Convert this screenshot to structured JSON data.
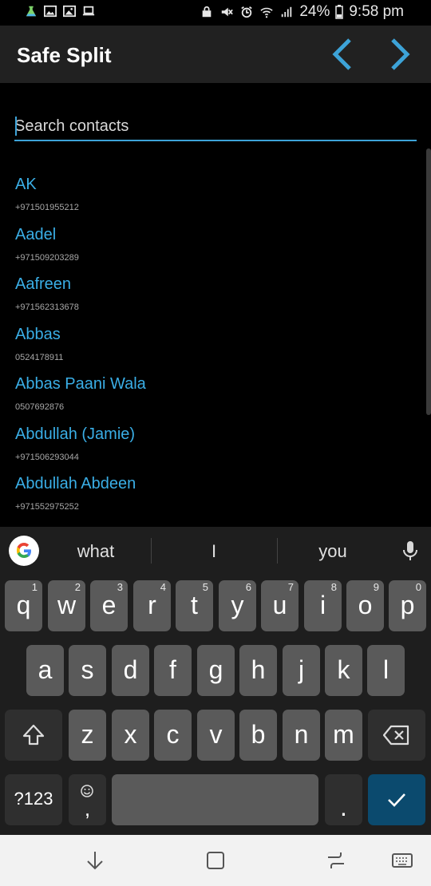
{
  "status_bar": {
    "battery": "24%",
    "time": "9:58 pm",
    "left_icons": [
      "flask-icon",
      "photo-icon",
      "image-icon",
      "laptop-icon"
    ],
    "right_icons": [
      "vpn-icon",
      "mute-icon",
      "alarm-icon",
      "wifi-icon",
      "signal-icon",
      "battery-icon"
    ]
  },
  "app_bar": {
    "title": "Safe Split",
    "prev_icon": "chevron-left-icon",
    "next_icon": "chevron-right-icon",
    "accent": "#3da3d8"
  },
  "search": {
    "placeholder": "Search contacts",
    "value": ""
  },
  "contacts": [
    {
      "name": "AK",
      "phone": "+971501955212"
    },
    {
      "name": "Aadel",
      "phone": "+971509203289"
    },
    {
      "name": "Aafreen",
      "phone": "+971562313678"
    },
    {
      "name": "Abbas",
      "phone": "0524178911"
    },
    {
      "name": "Abbas Paani Wala",
      "phone": "0507692876"
    },
    {
      "name": "Abdullah (Jamie)",
      "phone": "+971506293044"
    },
    {
      "name": "Abdullah Abdeen",
      "phone": "+971552975252"
    }
  ],
  "keyboard": {
    "suggestions": [
      "what",
      "I",
      "you"
    ],
    "row1": [
      {
        "key": "q",
        "hint": "1"
      },
      {
        "key": "w",
        "hint": "2"
      },
      {
        "key": "e",
        "hint": "3"
      },
      {
        "key": "r",
        "hint": "4"
      },
      {
        "key": "t",
        "hint": "5"
      },
      {
        "key": "y",
        "hint": "6"
      },
      {
        "key": "u",
        "hint": "7"
      },
      {
        "key": "i",
        "hint": "8"
      },
      {
        "key": "o",
        "hint": "9"
      },
      {
        "key": "p",
        "hint": "0"
      }
    ],
    "row2": [
      "a",
      "s",
      "d",
      "f",
      "g",
      "h",
      "j",
      "k",
      "l"
    ],
    "row3": [
      "z",
      "x",
      "c",
      "v",
      "b",
      "n",
      "m"
    ],
    "symbols_label": "?123",
    "comma": ",",
    "period": "."
  },
  "nav_bar": {
    "icons": [
      "collapse-down-icon",
      "home-square-icon",
      "recents-icon",
      "keyboard-icon"
    ]
  }
}
